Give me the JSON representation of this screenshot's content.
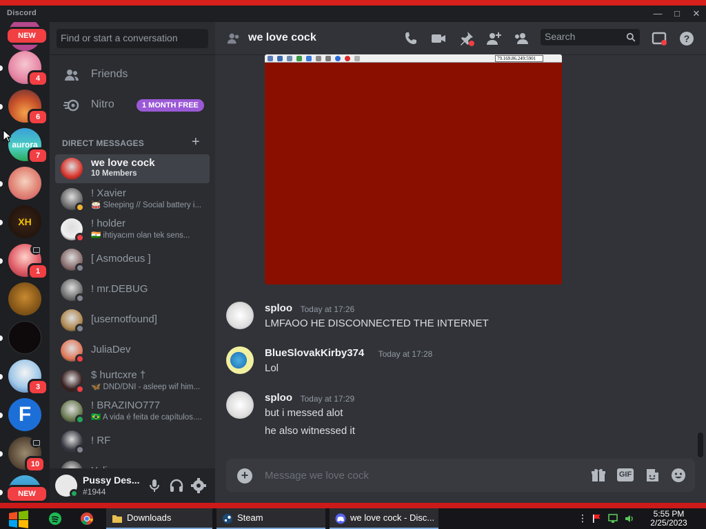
{
  "window": {
    "app_name": "Discord"
  },
  "rail": {
    "badges": [
      "NEW",
      "4",
      "6",
      "7",
      "1",
      "3",
      "10",
      "NEW"
    ],
    "aurora_label": "aurora",
    "xh_label": "XH"
  },
  "sidebar": {
    "search_placeholder": "Find or start a conversation",
    "friends_label": "Friends",
    "nitro_label": "Nitro",
    "nitro_badge": "1 MONTH FREE",
    "dm_header": "DIRECT MESSAGES",
    "dms": [
      {
        "name": "we love cock",
        "sub": "10 Members",
        "status": "none",
        "color": "#d9342b"
      },
      {
        "name": "! Xavier",
        "sub": "🥁 Sleeping // Social battery i...",
        "status": "idle",
        "color": "#6b6b6b"
      },
      {
        "name": "! holder",
        "sub": "🇮🇳 ihtiyacım olan tek sens...",
        "status": "dnd",
        "color": "#f0f0f0"
      },
      {
        "name": "[ Asmodeus ]",
        "sub": "",
        "status": "offline",
        "color": "#8a6e6e"
      },
      {
        "name": "! mr.DEBUG",
        "sub": "",
        "status": "offline",
        "color": "#707070"
      },
      {
        "name": "[usernotfound]",
        "sub": "",
        "status": "offline",
        "color": "#b08850"
      },
      {
        "name": "JuliaDev",
        "sub": "",
        "status": "dnd",
        "color": "#e0785a"
      },
      {
        "name": "$ hurtcxre †",
        "sub": "🦋 DND/DNI - asleep wif him...",
        "status": "dnd",
        "color": "#3a2020"
      },
      {
        "name": "! BRAZINO777",
        "sub": "🇧🇷 A vida é feita de capítulos....",
        "status": "online",
        "color": "#6a7a50"
      },
      {
        "name": "! RF",
        "sub": "",
        "status": "offline",
        "color": "#3a3a44"
      },
      {
        "name": "Yeliz",
        "sub": "",
        "status": "offline",
        "color": "#555555"
      }
    ]
  },
  "user": {
    "name": "Pussy Des...",
    "tag": "#1944"
  },
  "chat": {
    "channel_name": "we love cock",
    "search_placeholder": "Search",
    "embed_ip": "79.169.86.249:5901",
    "messages": [
      {
        "author": "sploo",
        "time": "Today at 17:26",
        "lines": [
          "LMFAOO HE DISCONNECTED THE INTERNET"
        ],
        "avatar": "troll"
      },
      {
        "author": "BlueSlovakKirby374",
        "time": "Today at 17:28",
        "lines": [
          "Lol"
        ],
        "avatar": "kirby"
      },
      {
        "author": "sploo",
        "time": "Today at 17:29",
        "lines": [
          "but i messed alot",
          "he also witnessed it"
        ],
        "avatar": "troll"
      }
    ],
    "composer_placeholder": "Message we love cock",
    "gif_label": "GIF"
  },
  "taskbar": {
    "tasks": [
      "Downloads",
      "Steam",
      "we love cock - Disc..."
    ],
    "time": "5:55 PM",
    "date": "2/25/2023"
  },
  "colors": {
    "accent": "#5865f2",
    "danger": "#f23f43",
    "online": "#23a55a",
    "idle": "#f0b232",
    "nitro": "#9b59d6"
  }
}
